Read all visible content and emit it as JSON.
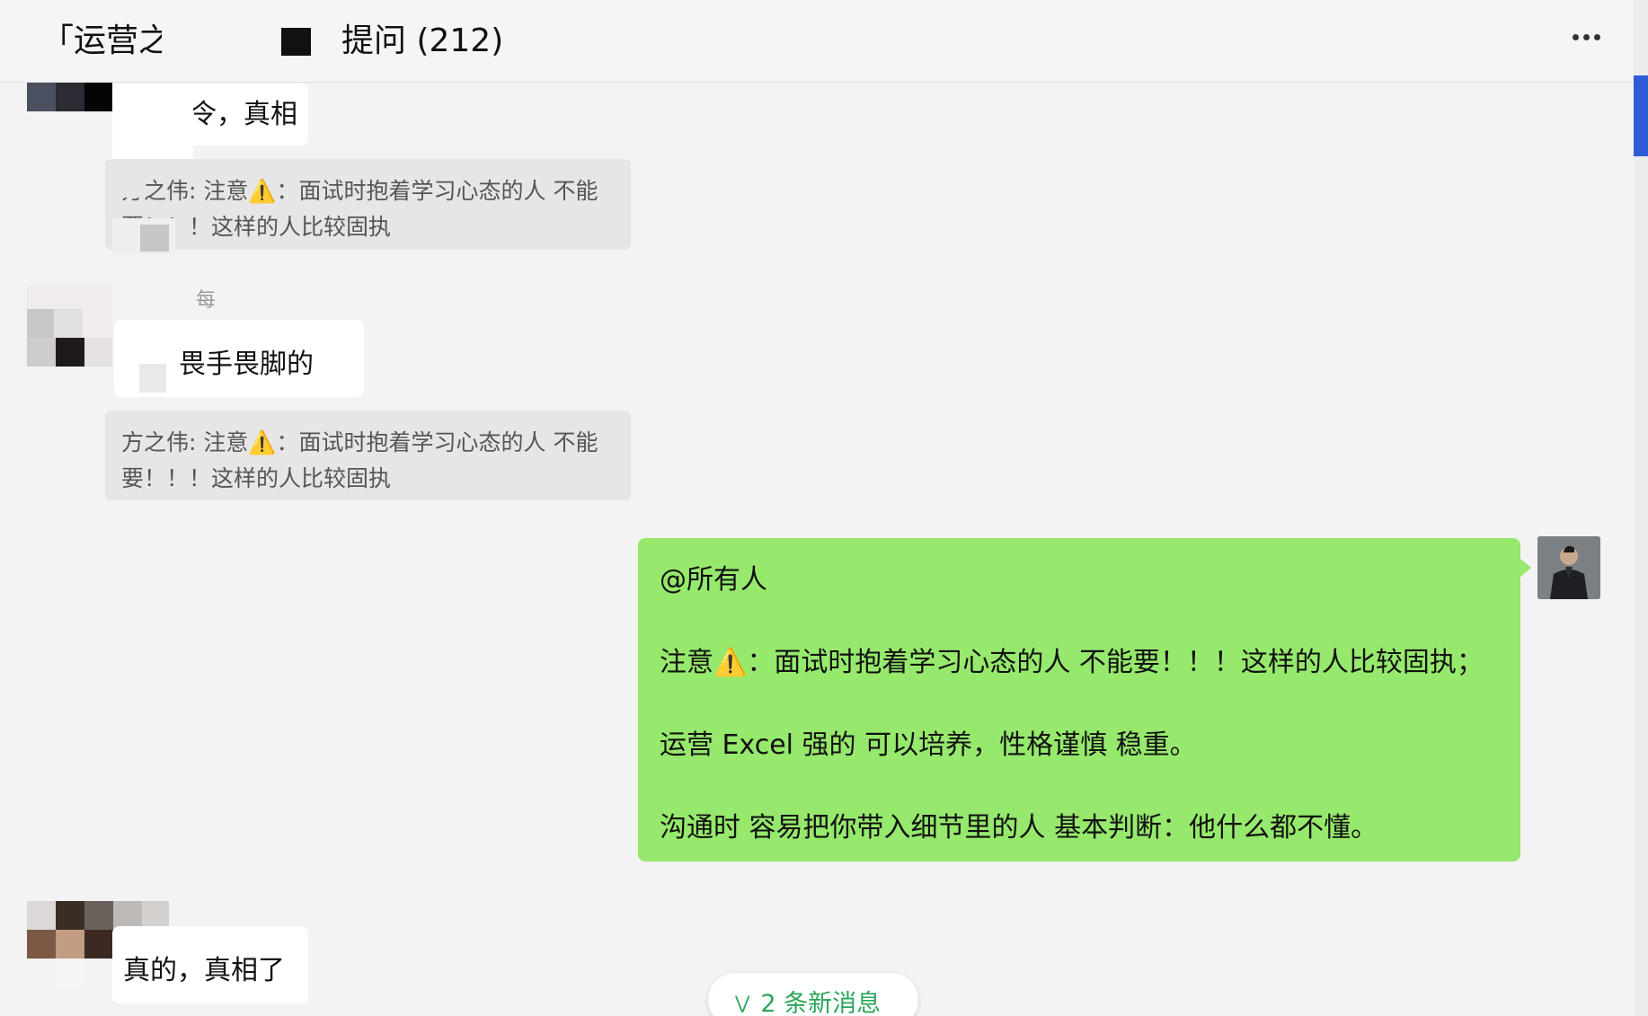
{
  "header": {
    "title_prefix": "「运营之",
    "title_suffix": "提问 (212)"
  },
  "messages": [
    {
      "partial_text": "令，真相"
    },
    {
      "quote_line1": "方之伟: 注意⚠️：面试时抱着学习心态的人 不能",
      "quote_line2": "要！！！这样的人比较固执"
    },
    {
      "sender_fragment": "每",
      "partial_text": "，畏手畏脚的"
    },
    {
      "quote_line1": "方之伟: 注意⚠️：面试时抱着学习心态的人 不能",
      "quote_line2": "要！！！这样的人比较固执"
    }
  ],
  "self_message": {
    "line1": "@所有人",
    "line2": "注意⚠️：面试时抱着学习心态的人 不能要！！！这样的人比较固执；",
    "line3": "运营 Excel 强的 可以培养，性格谨慎 稳重。",
    "line4": "沟通时 容易把你带入细节里的人 基本判断：他什么都不懂。"
  },
  "last_message": {
    "partial_text": "真的，真相了"
  },
  "new_messages": {
    "label": "2 条新消息"
  },
  "colors": {
    "self_bubble": "#96e96c",
    "scroll_thumb": "#2e5bd6",
    "new_msg_text": "#2aa55a"
  }
}
